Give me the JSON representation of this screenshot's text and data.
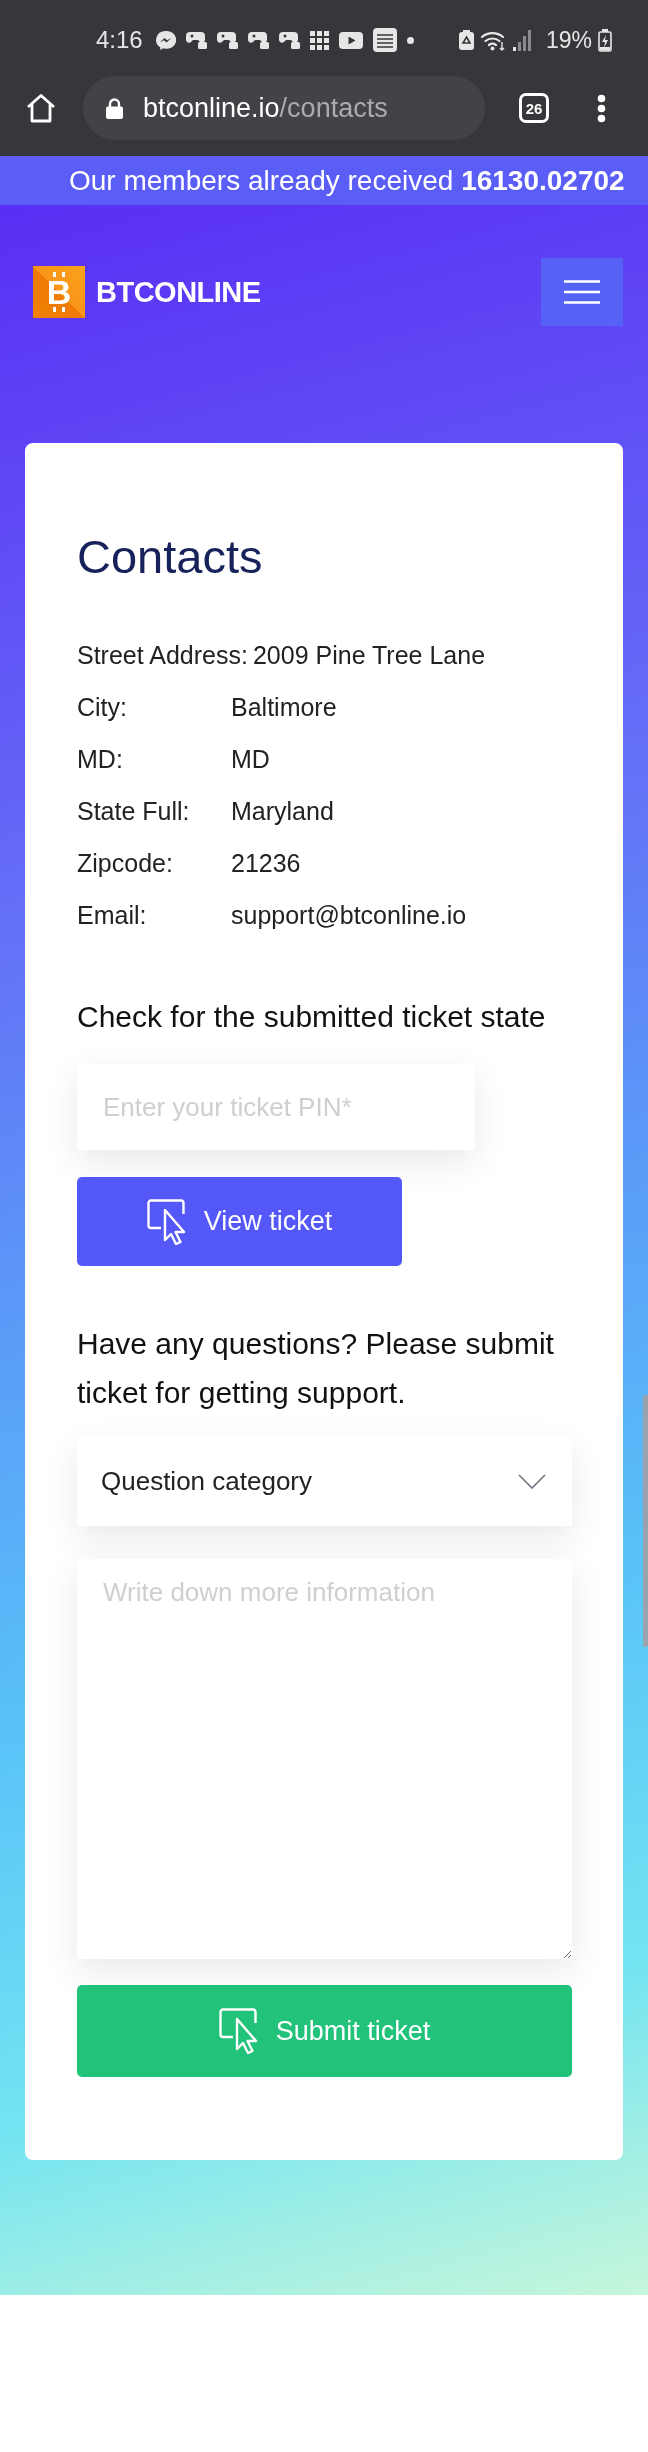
{
  "status_bar": {
    "time": "4:16",
    "battery": "19%"
  },
  "browser": {
    "url_host": "btconline.io",
    "url_path": "/contacts",
    "tab_count": "26"
  },
  "announcement": {
    "text": "Our members already received **16130.02702**"
  },
  "header": {
    "logo_mark": "B",
    "logo_text": "BTCONLINE"
  },
  "contacts": {
    "title": "Contacts",
    "rows": [
      {
        "label": "Street Address:",
        "value": "2009 Pine Tree Lane"
      },
      {
        "label": "City:",
        "value": "Baltimore"
      },
      {
        "label": "MD:",
        "value": "MD"
      },
      {
        "label": "State Full:",
        "value": "Maryland"
      },
      {
        "label": "Zipcode:",
        "value": "21236"
      },
      {
        "label": "Email:",
        "value": "support@btconline.io"
      }
    ]
  },
  "ticket_check": {
    "heading": "Check for the submitted ticket state",
    "pin_field": {
      "placeholder": "Enter your ticket PIN*"
    },
    "button": "View ticket"
  },
  "support": {
    "heading": "Have any questions? Please submit ticket for getting support.",
    "category_dropdown": {
      "label": "Question category"
    },
    "message_field": {
      "placeholder": "Write down more information"
    },
    "button": "Submit ticket"
  }
}
